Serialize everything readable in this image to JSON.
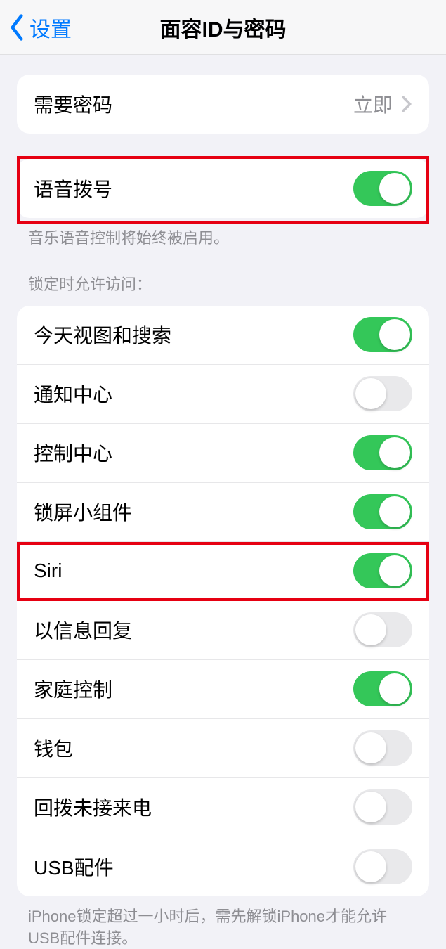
{
  "nav": {
    "back_label": "设置",
    "title": "面容ID与密码"
  },
  "passcode_row": {
    "label": "需要密码",
    "value": "立即"
  },
  "voice_dial": {
    "label": "语音拨号",
    "on": true,
    "footer": "音乐语音控制将始终被启用。"
  },
  "lock_section": {
    "header": "锁定时允许访问：",
    "items": [
      {
        "label": "今天视图和搜索",
        "on": true
      },
      {
        "label": "通知中心",
        "on": false
      },
      {
        "label": "控制中心",
        "on": true
      },
      {
        "label": "锁屏小组件",
        "on": true
      },
      {
        "label": "Siri",
        "on": true
      },
      {
        "label": "以信息回复",
        "on": false
      },
      {
        "label": "家庭控制",
        "on": true
      },
      {
        "label": "钱包",
        "on": false
      },
      {
        "label": "回拨未接来电",
        "on": false
      },
      {
        "label": "USB配件",
        "on": false
      }
    ],
    "footer": "iPhone锁定超过一小时后，需先解锁iPhone才能允许USB配件连接。"
  },
  "highlight_indices": [
    4
  ]
}
